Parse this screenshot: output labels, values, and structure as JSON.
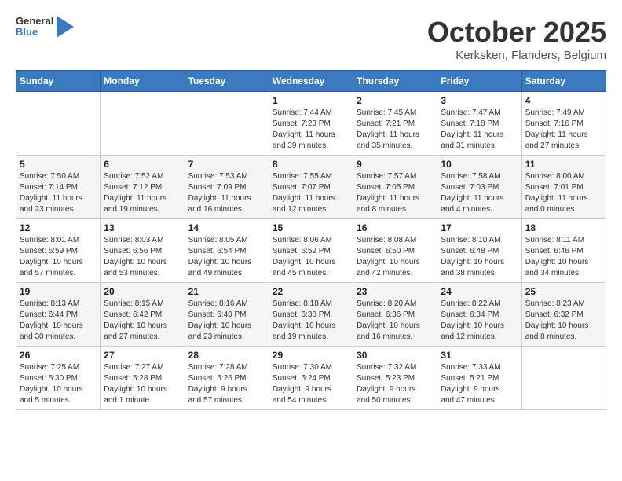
{
  "header": {
    "logo_general": "General",
    "logo_blue": "Blue",
    "month": "October 2025",
    "location": "Kerksken, Flanders, Belgium"
  },
  "weekdays": [
    "Sunday",
    "Monday",
    "Tuesday",
    "Wednesday",
    "Thursday",
    "Friday",
    "Saturday"
  ],
  "weeks": [
    [
      {
        "day": "",
        "info": ""
      },
      {
        "day": "",
        "info": ""
      },
      {
        "day": "",
        "info": ""
      },
      {
        "day": "1",
        "info": "Sunrise: 7:44 AM\nSunset: 7:23 PM\nDaylight: 11 hours\nand 39 minutes."
      },
      {
        "day": "2",
        "info": "Sunrise: 7:45 AM\nSunset: 7:21 PM\nDaylight: 11 hours\nand 35 minutes."
      },
      {
        "day": "3",
        "info": "Sunrise: 7:47 AM\nSunset: 7:18 PM\nDaylight: 11 hours\nand 31 minutes."
      },
      {
        "day": "4",
        "info": "Sunrise: 7:49 AM\nSunset: 7:16 PM\nDaylight: 11 hours\nand 27 minutes."
      }
    ],
    [
      {
        "day": "5",
        "info": "Sunrise: 7:50 AM\nSunset: 7:14 PM\nDaylight: 11 hours\nand 23 minutes."
      },
      {
        "day": "6",
        "info": "Sunrise: 7:52 AM\nSunset: 7:12 PM\nDaylight: 11 hours\nand 19 minutes."
      },
      {
        "day": "7",
        "info": "Sunrise: 7:53 AM\nSunset: 7:09 PM\nDaylight: 11 hours\nand 16 minutes."
      },
      {
        "day": "8",
        "info": "Sunrise: 7:55 AM\nSunset: 7:07 PM\nDaylight: 11 hours\nand 12 minutes."
      },
      {
        "day": "9",
        "info": "Sunrise: 7:57 AM\nSunset: 7:05 PM\nDaylight: 11 hours\nand 8 minutes."
      },
      {
        "day": "10",
        "info": "Sunrise: 7:58 AM\nSunset: 7:03 PM\nDaylight: 11 hours\nand 4 minutes."
      },
      {
        "day": "11",
        "info": "Sunrise: 8:00 AM\nSunset: 7:01 PM\nDaylight: 11 hours\nand 0 minutes."
      }
    ],
    [
      {
        "day": "12",
        "info": "Sunrise: 8:01 AM\nSunset: 6:59 PM\nDaylight: 10 hours\nand 57 minutes."
      },
      {
        "day": "13",
        "info": "Sunrise: 8:03 AM\nSunset: 6:56 PM\nDaylight: 10 hours\nand 53 minutes."
      },
      {
        "day": "14",
        "info": "Sunrise: 8:05 AM\nSunset: 6:54 PM\nDaylight: 10 hours\nand 49 minutes."
      },
      {
        "day": "15",
        "info": "Sunrise: 8:06 AM\nSunset: 6:52 PM\nDaylight: 10 hours\nand 45 minutes."
      },
      {
        "day": "16",
        "info": "Sunrise: 8:08 AM\nSunset: 6:50 PM\nDaylight: 10 hours\nand 42 minutes."
      },
      {
        "day": "17",
        "info": "Sunrise: 8:10 AM\nSunset: 6:48 PM\nDaylight: 10 hours\nand 38 minutes."
      },
      {
        "day": "18",
        "info": "Sunrise: 8:11 AM\nSunset: 6:46 PM\nDaylight: 10 hours\nand 34 minutes."
      }
    ],
    [
      {
        "day": "19",
        "info": "Sunrise: 8:13 AM\nSunset: 6:44 PM\nDaylight: 10 hours\nand 30 minutes."
      },
      {
        "day": "20",
        "info": "Sunrise: 8:15 AM\nSunset: 6:42 PM\nDaylight: 10 hours\nand 27 minutes."
      },
      {
        "day": "21",
        "info": "Sunrise: 8:16 AM\nSunset: 6:40 PM\nDaylight: 10 hours\nand 23 minutes."
      },
      {
        "day": "22",
        "info": "Sunrise: 8:18 AM\nSunset: 6:38 PM\nDaylight: 10 hours\nand 19 minutes."
      },
      {
        "day": "23",
        "info": "Sunrise: 8:20 AM\nSunset: 6:36 PM\nDaylight: 10 hours\nand 16 minutes."
      },
      {
        "day": "24",
        "info": "Sunrise: 8:22 AM\nSunset: 6:34 PM\nDaylight: 10 hours\nand 12 minutes."
      },
      {
        "day": "25",
        "info": "Sunrise: 8:23 AM\nSunset: 6:32 PM\nDaylight: 10 hours\nand 8 minutes."
      }
    ],
    [
      {
        "day": "26",
        "info": "Sunrise: 7:25 AM\nSunset: 5:30 PM\nDaylight: 10 hours\nand 5 minutes."
      },
      {
        "day": "27",
        "info": "Sunrise: 7:27 AM\nSunset: 5:28 PM\nDaylight: 10 hours\nand 1 minute."
      },
      {
        "day": "28",
        "info": "Sunrise: 7:28 AM\nSunset: 5:26 PM\nDaylight: 9 hours\nand 57 minutes."
      },
      {
        "day": "29",
        "info": "Sunrise: 7:30 AM\nSunset: 5:24 PM\nDaylight: 9 hours\nand 54 minutes."
      },
      {
        "day": "30",
        "info": "Sunrise: 7:32 AM\nSunset: 5:23 PM\nDaylight: 9 hours\nand 50 minutes."
      },
      {
        "day": "31",
        "info": "Sunrise: 7:33 AM\nSunset: 5:21 PM\nDaylight: 9 hours\nand 47 minutes."
      },
      {
        "day": "",
        "info": ""
      }
    ]
  ]
}
